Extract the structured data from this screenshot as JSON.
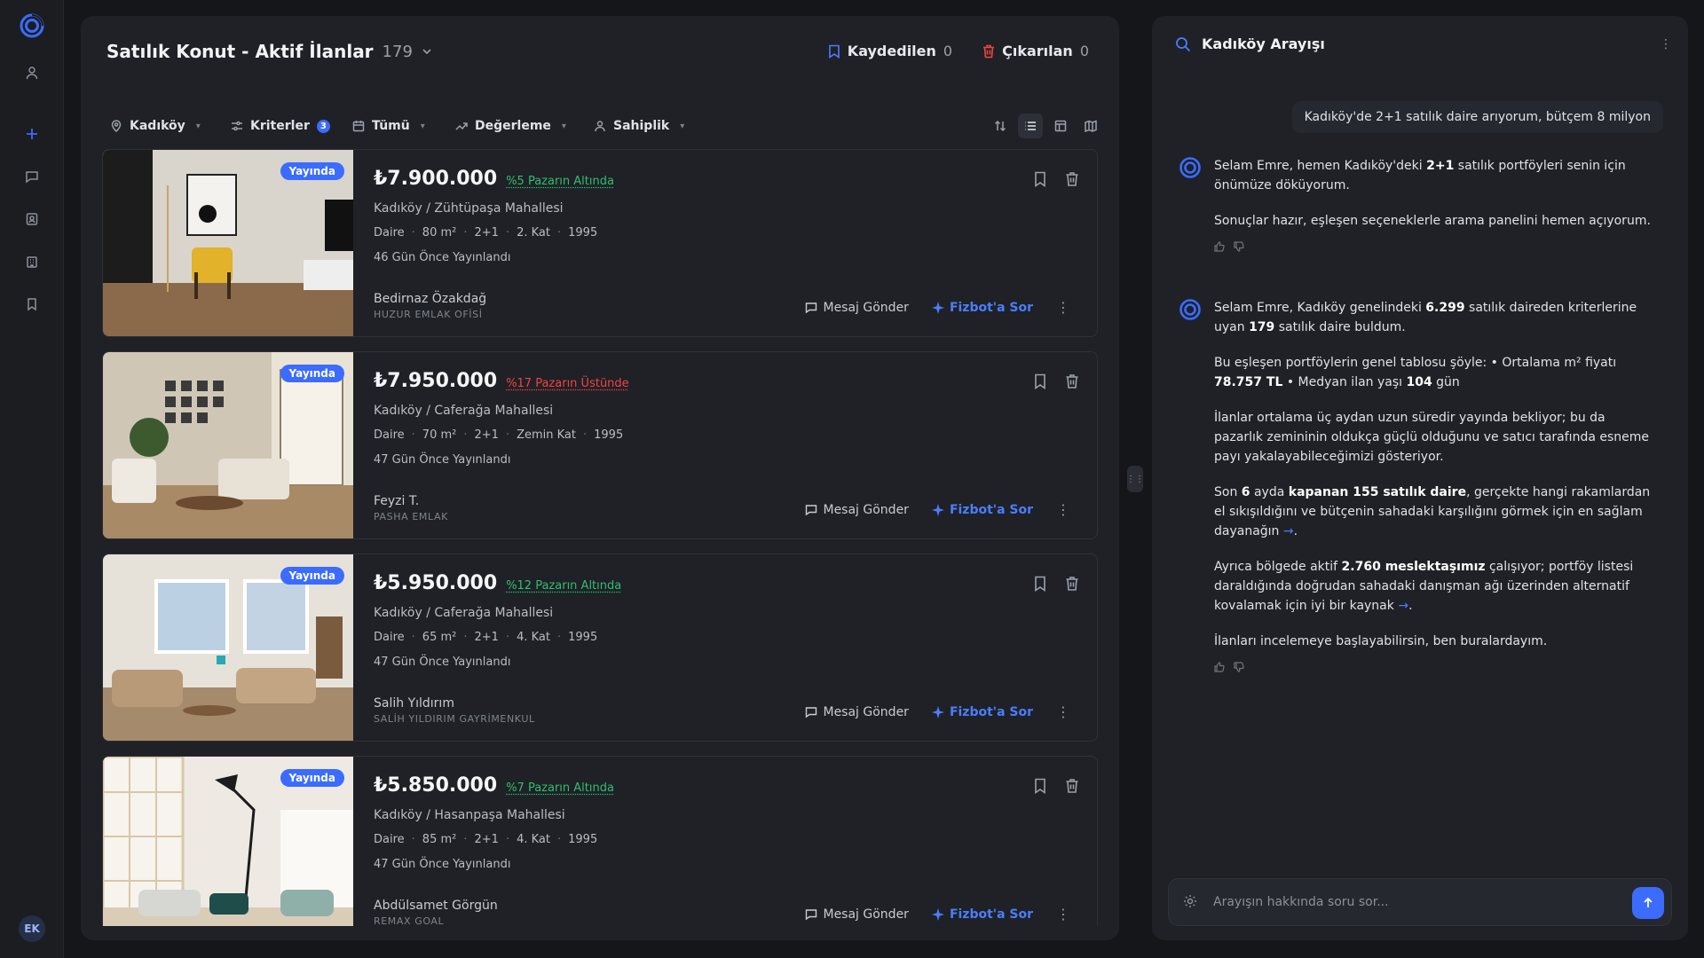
{
  "sidebar": {
    "avatar_initials": "EK"
  },
  "listings_header": {
    "title": "Satılık Konut - Aktif İlanlar",
    "count": "179",
    "saved_label": "Kaydedilen",
    "saved_count": "0",
    "removed_label": "Çıkarılan",
    "removed_count": "0"
  },
  "filters": {
    "location": "Kadıköy",
    "criteria": "Kriterler",
    "criteria_count": "3",
    "date": "Tümü",
    "valuation": "Değerleme",
    "ownership": "Sahiplik"
  },
  "listings": [
    {
      "status": "Yayında",
      "price": "₺7.900.000",
      "market_diff": "%5 Pazarın Altında",
      "location": "Kadıköy / Zühtüpaşa Mahallesi",
      "type": "Daire",
      "area": "80 m²",
      "rooms": "2+1",
      "floor": "2. Kat",
      "year": "1995",
      "posted": "46 Gün Önce Yayınlandı",
      "agent": "Bedirnaz Özakdağ",
      "office": "HUZUR EMLAK OFİSİ",
      "message_label": "Mesaj Gönder",
      "ask_label": "Fizbot'a Sor"
    },
    {
      "status": "Yayında",
      "price": "₺7.950.000",
      "market_diff": "%17 Pazarın Üstünde",
      "location": "Kadıköy / Caferağa Mahallesi",
      "type": "Daire",
      "area": "70 m²",
      "rooms": "2+1",
      "floor": "Zemin Kat",
      "year": "1995",
      "posted": "47 Gün Önce Yayınlandı",
      "agent": "Feyzi T.",
      "office": "PASHA EMLAK",
      "message_label": "Mesaj Gönder",
      "ask_label": "Fizbot'a Sor"
    },
    {
      "status": "Yayında",
      "price": "₺5.950.000",
      "market_diff": "%12 Pazarın Altında",
      "location": "Kadıköy / Caferağa Mahallesi",
      "type": "Daire",
      "area": "65 m²",
      "rooms": "2+1",
      "floor": "4. Kat",
      "year": "1995",
      "posted": "47 Gün Önce Yayınlandı",
      "agent": "Salih Yıldırım",
      "office": "SALİH YILDIRIM GAYRİMENKUL",
      "message_label": "Mesaj Gönder",
      "ask_label": "Fizbot'a Sor"
    },
    {
      "status": "Yayında",
      "price": "₺5.850.000",
      "market_diff": "%7 Pazarın Altında",
      "location": "Kadıköy / Hasanpaşa Mahallesi",
      "type": "Daire",
      "area": "85 m²",
      "rooms": "2+1",
      "floor": "4. Kat",
      "year": "1995",
      "posted": "47 Gün Önce Yayınlandı",
      "agent": "Abdülsamet Görgün",
      "office": "REMAX GOAL",
      "message_label": "Mesaj Gönder",
      "ask_label": "Fizbot'a Sor"
    }
  ],
  "colors": {
    "accent": "#3b6cff",
    "below_market": "#2fbf71",
    "above_market": "#ef4444"
  },
  "chat": {
    "title": "Kadıköy Arayışı",
    "user_message": "Kadıköy'de 2+1 satılık daire arıyorum, bütçem 8 milyon",
    "bot1": {
      "p1_a": "Selam Emre, hemen Kadıköy'deki ",
      "p1_b": "2+1",
      "p1_c": " satılık portföyleri senin için önümüze döküyorum.",
      "p2": "Sonuçlar hazır, eşleşen seçeneklerle arama panelini hemen açıyorum."
    },
    "bot2": {
      "p1_a": "Selam Emre, Kadıköy genelindeki ",
      "p1_b": "6.299",
      "p1_c": " satılık daireden kriterlerine uyan ",
      "p1_d": "179",
      "p1_e": " satılık daire buldum.",
      "p2_a": "Bu eşleşen portföylerin genel tablosu şöyle: • Ortalama m² fiyatı ",
      "p2_b": "78.757 TL",
      "p2_c": " • Medyan ilan yaşı ",
      "p2_d": "104",
      "p2_e": " gün",
      "p3": "İlanlar ortalama üç aydan uzun süredir yayında bekliyor; bu da pazarlık zemininin oldukça güçlü olduğunu ve satıcı tarafında esneme payı yakalayabileceğimizi gösteriyor.",
      "p4_a": "Son ",
      "p4_b": "6",
      "p4_c": " ayda ",
      "p4_d": "kapanan 155 satılık daire",
      "p4_e": ", gerçekte hangi rakamlardan el sıkışıldığını ve bütçenin sahadaki karşılığını görmek için en sağlam dayanağın",
      "p5_a": "Ayrıca bölgede aktif ",
      "p5_b": "2.760 meslektaşımız",
      "p5_c": " çalışıyor; portföy listesi daraldığında doğrudan sahadaki danışman ağı üzerinden alternatif kovalamak için iyi bir kaynak",
      "p6": "İlanları incelemeye başlayabilirsin, ben buralardayım."
    },
    "composer_placeholder": "Arayışın hakkında soru sor..."
  }
}
